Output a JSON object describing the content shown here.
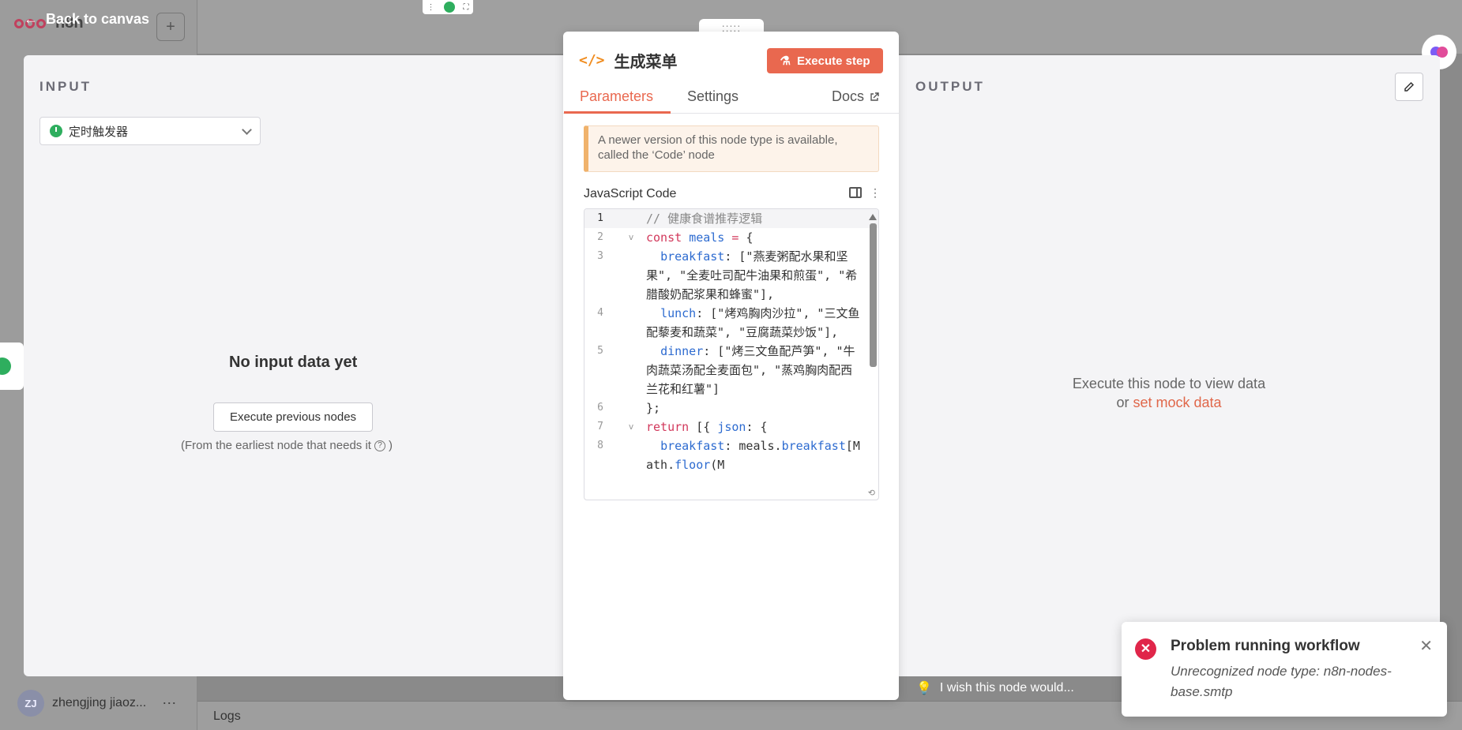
{
  "background": {
    "app_name": "n8n",
    "user": {
      "initials": "ZJ",
      "name": "zhengjing jiaoz..."
    },
    "logs_label": "Logs",
    "wish_text": "I wish this node would..."
  },
  "nav": {
    "back_label": "Back to canvas"
  },
  "input_panel": {
    "heading": "INPUT",
    "trigger_select": "定时触发器",
    "empty_title": "No input data yet",
    "execute_previous_label": "Execute previous nodes",
    "hint": "(From the earliest node that needs it",
    "hint_close": ")"
  },
  "output_panel": {
    "heading": "OUTPUT",
    "message": "Execute this node to view data",
    "or_text": "or",
    "mock_link": "set mock data"
  },
  "node": {
    "drag_handle": ":::::",
    "title": "生成菜单",
    "execute_label": "Execute step",
    "tabs": [
      {
        "label": "Parameters",
        "active": true
      },
      {
        "label": "Settings",
        "active": false
      }
    ],
    "docs_label": "Docs",
    "notice": "A newer version of this node type is available, called the ‘Code’ node",
    "code_label": "JavaScript Code",
    "code_lines": [
      {
        "n": "1",
        "fold": "",
        "segments": [
          [
            "c-com",
            "// 健康食谱推荐逻辑"
          ]
        ]
      },
      {
        "n": "2",
        "fold": "v",
        "segments": [
          [
            "c-kw",
            "const "
          ],
          [
            "c-var",
            "meals"
          ],
          [
            "c-kw",
            " = "
          ],
          [
            "",
            "{"
          ]
        ]
      },
      {
        "n": "3",
        "fold": "",
        "segments": [
          [
            "",
            "  "
          ],
          [
            "c-var",
            "breakfast"
          ],
          [
            "",
            ": [\"燕麦粥配水果和坚果\", \"全麦吐司配牛油果和煎蛋\", \"希腊酸奶配浆果和蜂蜜\"],"
          ]
        ]
      },
      {
        "n": "4",
        "fold": "",
        "segments": [
          [
            "",
            "  "
          ],
          [
            "c-var",
            "lunch"
          ],
          [
            "",
            ": [\"烤鸡胸肉沙拉\", \"三文鱼配藜麦和蔬菜\", \"豆腐蔬菜炒饭\"],"
          ]
        ]
      },
      {
        "n": "5",
        "fold": "",
        "segments": [
          [
            "",
            "  "
          ],
          [
            "c-var",
            "dinner"
          ],
          [
            "",
            ": [\"烤三文鱼配芦笋\", \"牛肉蔬菜汤配全麦面包\", \"蒸鸡胸肉配西兰花和红薯\"]"
          ]
        ]
      },
      {
        "n": "6",
        "fold": "",
        "segments": [
          [
            "",
            "};"
          ]
        ]
      },
      {
        "n": "7",
        "fold": "v",
        "segments": [
          [
            "c-kw",
            "return "
          ],
          [
            "",
            "[{ "
          ],
          [
            "c-var",
            "json"
          ],
          [
            "",
            ": {"
          ]
        ]
      },
      {
        "n": "8",
        "fold": "",
        "segments": [
          [
            "",
            "  "
          ],
          [
            "c-var",
            "breakfast"
          ],
          [
            "",
            ": meals."
          ],
          [
            "c-var",
            "breakfast"
          ],
          [
            "",
            "[Math."
          ],
          [
            "c-var",
            "floor"
          ],
          [
            "",
            "(M"
          ]
        ]
      }
    ]
  },
  "toast": {
    "title": "Problem running workflow",
    "message": "Unrecognized node type: n8n-nodes-base.smtp"
  },
  "colors": {
    "accent": "#e9684f",
    "success": "#2eae5e",
    "error": "#e0264a"
  }
}
